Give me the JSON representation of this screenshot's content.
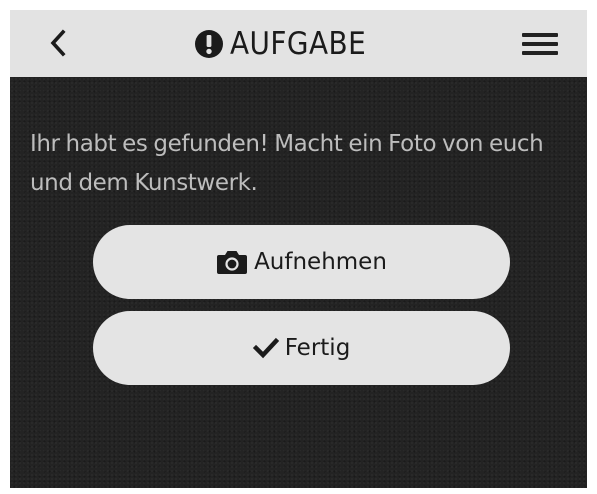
{
  "header": {
    "title": "AUFGABE",
    "back_icon": "chevron-left-icon",
    "title_icon": "exclamation-circle-icon",
    "menu_icon": "hamburger-menu-icon"
  },
  "main": {
    "instruction": "Ihr habt es gefunden! Macht ein Foto von euch und dem Kunstwerk.",
    "record_button": {
      "label": "Aufnehmen",
      "icon": "camera-icon"
    },
    "done_button": {
      "label": "Fertig",
      "icon": "checkmark-icon"
    }
  },
  "colors": {
    "header_background": "#e3e3e3",
    "content_background": "#232323",
    "button_background": "#e4e4e4",
    "instruction_text": "#bdbdbd",
    "dark_text": "#1b1b1b"
  }
}
